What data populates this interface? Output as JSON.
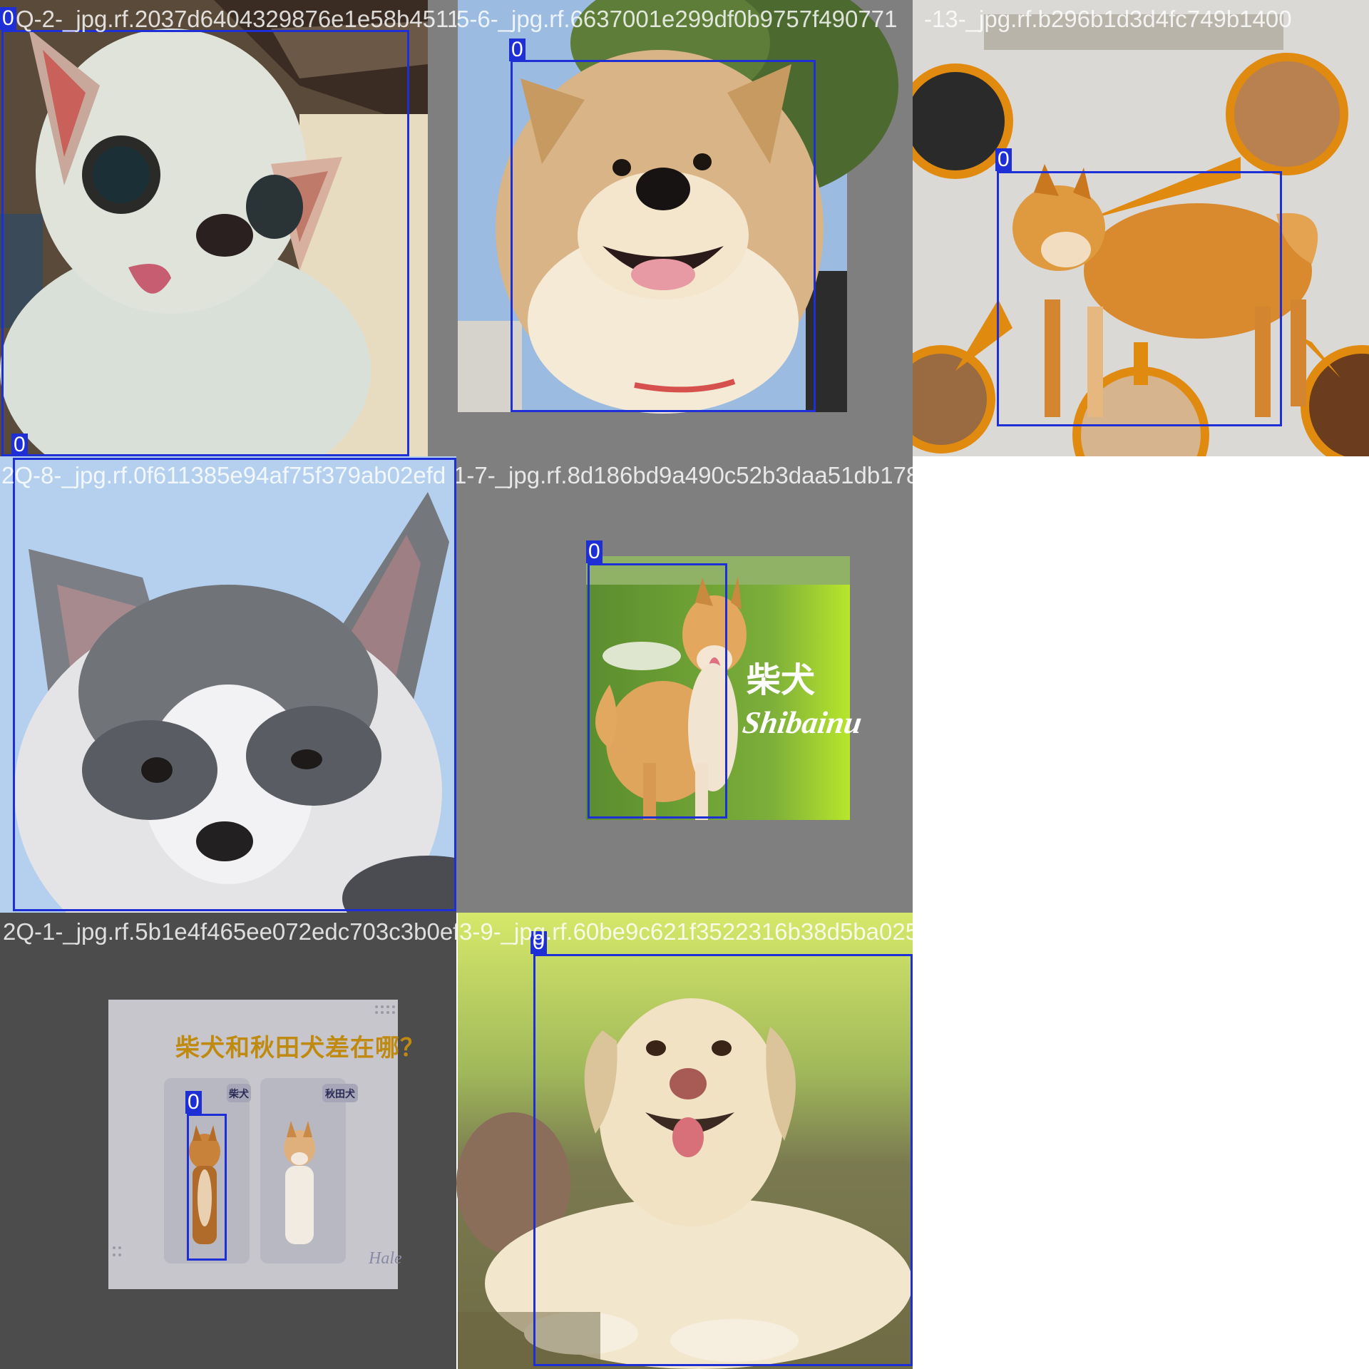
{
  "tiles": [
    {
      "filename": "Q-2-_jpg.rf.2037d6404329876e1e58b45115",
      "class_label": "0"
    },
    {
      "filename": "5-6-_jpg.rf.6637001e299df0b9757f490771",
      "class_label": "0"
    },
    {
      "filename": "-13-_jpg.rf.b296b1d3d4fc749b1400",
      "class_label": "0"
    },
    {
      "filename": "2Q-8-_jpg.rf.0f611385e94af75f379ab02efd",
      "class_label": "0"
    },
    {
      "filename": "1-7-_jpg.rf.8d186bd9a490c52b3daa51db178a",
      "class_label": "0",
      "picture_text": {
        "title_cn": "柴犬",
        "title_en": "Shibainu"
      }
    },
    {
      "filename": "2Q-1-_jpg.rf.5b1e4f465ee072edc703c3b0ef0",
      "class_label": "0",
      "picture_text": {
        "headline": "柴犬和秋田犬差在哪？",
        "tag_left": "柴犬",
        "tag_right": "秋田犬",
        "signature": "Hale"
      }
    },
    {
      "filename": "3-9-_jpg.rf.60be9c621f3522316b38d5ba025",
      "class_label": "0"
    }
  ]
}
